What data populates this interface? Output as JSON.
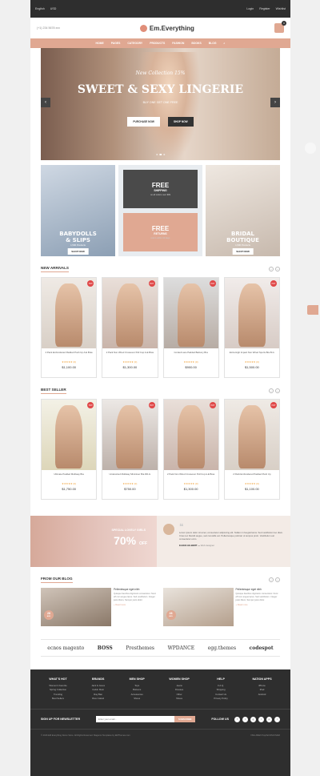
{
  "topbar": {
    "language": "English",
    "currency": "USD",
    "login": "Login",
    "register": "Register",
    "wishlist": "Wishlist"
  },
  "header": {
    "phone": "(+1) 234 5678 xxx",
    "logo": "Em.Everything",
    "cart_count": "0"
  },
  "nav": [
    "HOME",
    "PAGES",
    "CATEGORY",
    "PRODUCTS",
    "FASHION",
    "BOOKS",
    "BLOG"
  ],
  "hero": {
    "kicker": "New Collection 15%",
    "title": "SWEET & SEXY LINGERIE",
    "sub": "BUY ONE GET ONE FREE",
    "purchase": "PURCHASE NOW",
    "shop": "SHOP NOW"
  },
  "promo": {
    "left": {
      "title1": "BABYDOLLS",
      "title2": "& SLIPS",
      "sub": "1,500 Products",
      "btn": "SHOP NOW"
    },
    "shipping": {
      "big": "FREE",
      "sm": "SHIPPING",
      "xs": "on all orders over $99"
    },
    "returns": {
      "big": "FREE",
      "sm": "RETURNS",
      "xs": "return within 30 days"
    },
    "right": {
      "title1": "BRIDAL",
      "title2": "BOUTIQUE",
      "sub": "1,500 Products",
      "btn": "SHOP NOW"
    }
  },
  "new_arrivals": {
    "title": "NEW ARRIVALS",
    "items": [
      {
        "name": "2 Pack Embroidered Padded Push Up A-E Bras",
        "price": "$1,100.00",
        "badge": "HOT",
        "rating": "★★★★★ (0)"
      },
      {
        "name": "2 Pack Non Wired Crossover Pull Cup A-E Bras",
        "price": "$1,300.00",
        "badge": "HOT",
        "rating": "★★★★★ (0)"
      },
      {
        "name": "Corded Lace Padded Balcony Bra",
        "price": "$900.00",
        "badge": "HOT",
        "rating": "★★★★★ (0)"
      },
      {
        "name": "Extra High Impact Non Wired Sports Bra B-G",
        "price": "$1,500.00",
        "badge": "HOT",
        "rating": "★★★★★ (0)"
      }
    ]
  },
  "best_seller": {
    "title": "BEST SELLER",
    "items": [
      {
        "name": "Ultimate Padded Multiway Bra",
        "price": "$1,750.00",
        "badge": "HOT",
        "rating": "★★★★★ (0)"
      },
      {
        "name": "Underwired Multiway Minimiser Bra DD-G",
        "price": "$750.00",
        "badge": "HOT",
        "rating": "★★★★★ (0)"
      },
      {
        "name": "2 Pack Non Wired Crossover Pull Cup A-E Bras",
        "price": "$1,300.00",
        "badge": "HOT",
        "rating": "★★★★★ (0)"
      },
      {
        "name": "2 Pack Embroidered Padded Push Up",
        "price": "$1,100.00",
        "badge": "HOT",
        "rating": "★★★★★ (0)"
      }
    ]
  },
  "banner": {
    "label": "SPECIAL LOVELY GIRLS",
    "pct": "70%",
    "off": "OFF",
    "quote": "Lorem ipsum dolor sit amet, consectetur adipiscing elit. Nullam in feugiat lacus. Sed vestibulum leo diam. Cras nec blandit augue, sed convallis est. Pellentesque pulvinar ut tempus proin. Vestibulum est consectetur enim.",
    "author": "ELENA GILBERT",
    "role": "Web designer"
  },
  "blog": {
    "title": "FROM OUR BLOG",
    "posts": [
      {
        "day": "28",
        "month": "AUG",
        "title": "Pellentesque eget nibh",
        "text": "Quisque faucibus dignissim consectetur. Nunc eff cum angue lacus. Sed vestibulum. Integer justo libero, Semper justo dolor.",
        "more": "+ Read more"
      },
      {
        "day": "28",
        "month": "AUG",
        "title": "Pellentesque eget nibh",
        "text": "Quisque faucibus dignissim consectetur. Nunc eff cum angue lacus. Sed vestibulum. Integer justo libero, Semper justo dolor.",
        "more": "+ Read more"
      }
    ]
  },
  "brands": [
    "ecnos magento",
    "BOSS",
    "Presthemes",
    "WPDANCE",
    "egg.themes",
    "codespot"
  ],
  "footer": {
    "cols": [
      {
        "h": "WHAT'S HOT",
        "i": [
          "Women's Favorite",
          "Spring Collection",
          "Trending",
          "Best Sellers"
        ]
      },
      {
        "h": "BRANDS",
        "i": [
          "Jack & Jones",
          "Calvin Klein",
          "Ray Ban",
          "River Island"
        ]
      },
      {
        "h": "MEN SHOP",
        "i": [
          "Tops",
          "Bottoms",
          "Accessories",
          "Shoes"
        ]
      },
      {
        "h": "WOMEN SHOP",
        "i": [
          "Jeans",
          "Dresses",
          "Other",
          "Shoes"
        ]
      },
      {
        "h": "HELP",
        "i": [
          "F.A.Q.",
          "Shipping",
          "Contact Us",
          "Privacy Policy"
        ]
      },
      {
        "h": "NATION APPS",
        "i": [
          "iPhone",
          "iPad",
          "Android"
        ]
      }
    ],
    "newsletter": "SIGN UP FOR NEWSLETTER",
    "email_placeholder": "Enter your email...",
    "subscribe": "SUBSCRIBE",
    "follow": "FOLLOW US",
    "copyright": "© 2016 EM Everything Demo Store. All Rights Reserved. Magento Templates by EMThemes.com",
    "payments": "VISA  AMEX  PayPal  DISCOVER"
  },
  "colors": {
    "accent": "#e0a892",
    "dark": "#2e2e2e"
  }
}
